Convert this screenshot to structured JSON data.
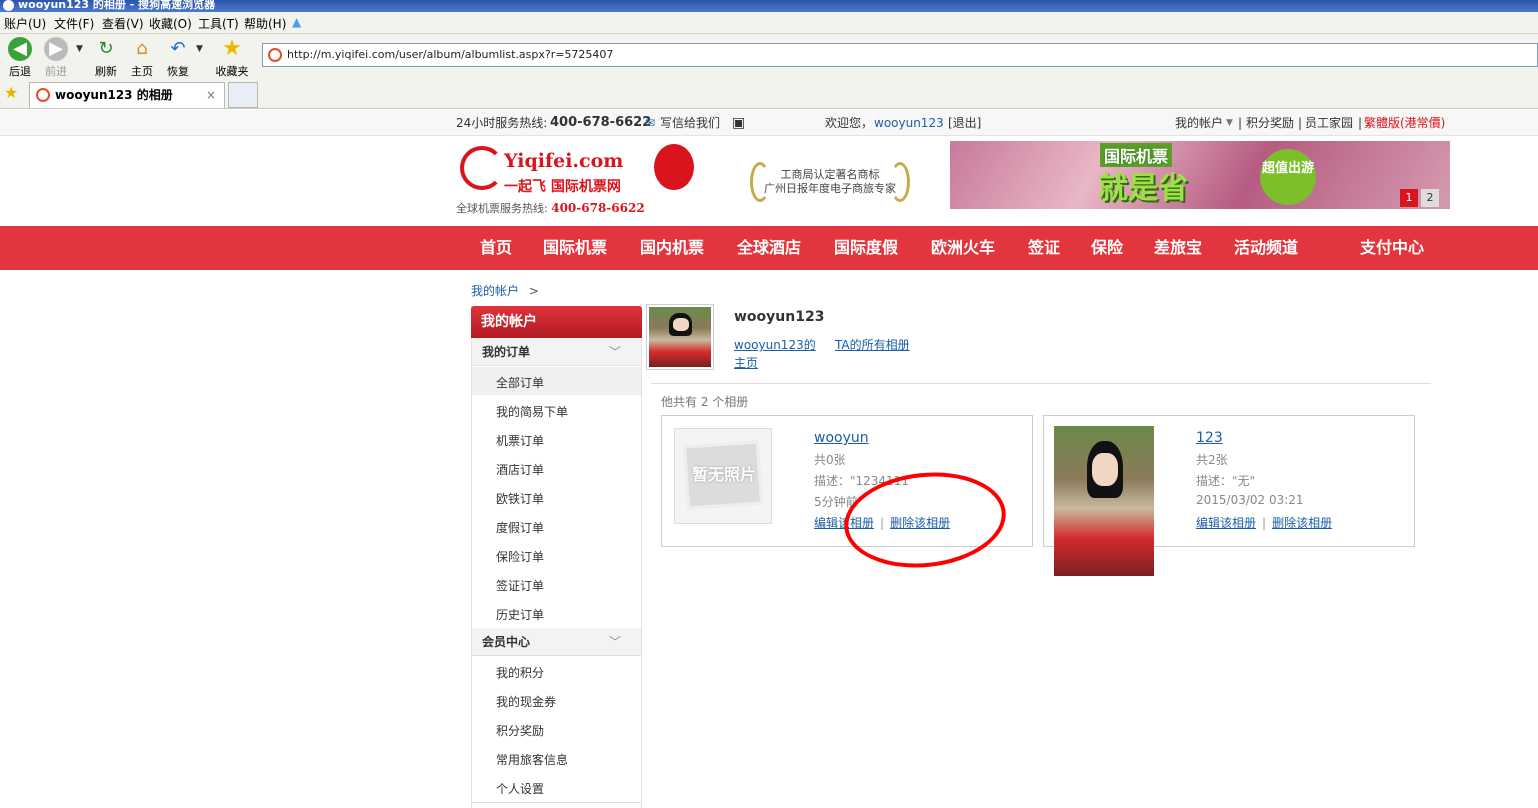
{
  "browser": {
    "window_title": "wooyun123 的相册 - 搜狗高速浏览器",
    "menu": [
      "账户(U)",
      "文件(F)",
      "查看(V)",
      "收藏(O)",
      "工具(T)",
      "帮助(H)"
    ],
    "toolbar": {
      "back": "后退",
      "forward": "前进",
      "refresh": "刷新",
      "home": "主页",
      "restore": "恢复",
      "favorites": "收藏夹"
    },
    "url": "http://m.yiqifei.com/user/album/albumlist.aspx?r=5725407",
    "tab_title": "wooyun123 的相册",
    "tab_close": "×"
  },
  "topbar": {
    "hotline_label": "24小时服务热线:",
    "hotline_number": "400-678-6622",
    "mail_label": "写信给我们",
    "welcome": "欢迎您，",
    "username": "wooyun123",
    "logout": "[退出]",
    "my_account": "我的帐户",
    "points": "积分奖励",
    "staff": "员工家园",
    "traditional": "繁體版(港常價)"
  },
  "header": {
    "brand": "Yiqifei.com",
    "brand_sub": "一起飞 国际机票网",
    "global_hotline_label": "全球机票服务热线:",
    "global_hotline_number": "400-678-6622",
    "award_line1": "工商局认定著名商标",
    "award_line2": "广州日报年度电子商旅专家",
    "banner_line1": "国际机票",
    "banner_line2": "就是省",
    "banner_badge": "超值出游",
    "banner_pages": [
      "1",
      "2"
    ]
  },
  "nav": [
    "首页",
    "国际机票",
    "国内机票",
    "全球酒店",
    "国际度假",
    "欧洲火车",
    "签证",
    "保险",
    "差旅宝",
    "活动频道",
    "支付中心"
  ],
  "breadcrumb": {
    "label": "我的帐户",
    "sep": ">"
  },
  "sidebar": {
    "title": "我的帐户",
    "section1": "我的订单",
    "orders": [
      "全部订单",
      "我的简易下单",
      "机票订单",
      "酒店订单",
      "欧铁订单",
      "度假订单",
      "保险订单",
      "签证订单",
      "历史订单"
    ],
    "section2": "会员中心",
    "member": [
      "我的积分",
      "我的现金券",
      "积分奖励",
      "常用旅客信息",
      "个人设置"
    ],
    "chevron": "﹀"
  },
  "profile": {
    "name": "wooyun123",
    "home_link": "wooyun123的主页",
    "all_albums": "TA的所有相册",
    "album_count_text": "他共有 2 个相册"
  },
  "albums": [
    {
      "title": "wooyun",
      "count": "共0张",
      "desc": "描述：\"1234111",
      "time": "5分钟前",
      "edit": "编辑该相册",
      "delete": "删除该相册",
      "nophoto": "暂无照片"
    },
    {
      "title": "123",
      "count": "共2张",
      "desc": "描述：\"无\"",
      "time": "2015/03/02 03:21",
      "edit": "编辑该相册",
      "delete": "删除该相册"
    }
  ],
  "colors": {
    "brand_red": "#e2353d",
    "link_blue": "#1a5ea8",
    "annotation_red": "#ff0000"
  }
}
